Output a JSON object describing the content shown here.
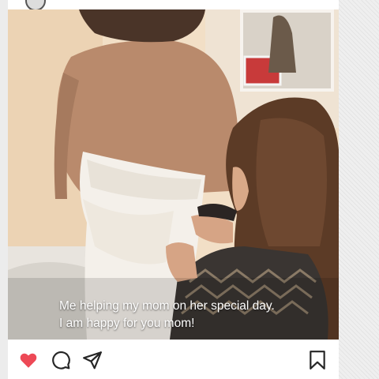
{
  "post": {
    "caption_line1": "Me helping my mom on her special day.",
    "caption_line2": "I am happy for you mom!",
    "liked": true
  },
  "actions": {
    "like_icon": "heart-filled-icon",
    "comment_icon": "comment-bubble-icon",
    "share_icon": "paper-plane-icon",
    "save_icon": "bookmark-icon"
  },
  "colors": {
    "like": "#ed4956",
    "icon_stroke": "#262626",
    "caption_text": "#ffffff"
  }
}
